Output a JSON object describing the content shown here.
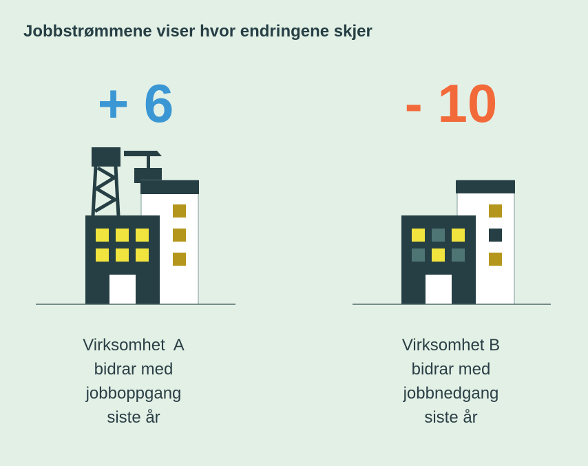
{
  "title": "Jobbstrømmene viser hvor endringene skjer",
  "colors": {
    "positive": "#3a97d4",
    "negative": "#f26a3a",
    "dark": "#263f44",
    "window_lit": "#f2e43f",
    "window_ochre": "#b5961d",
    "window_dim": "#4e7574",
    "background": "#e3f0e6"
  },
  "company_a": {
    "change": "+ 6",
    "label_lines": [
      "Virksomhet  A",
      "bidrar med",
      "jobboppgang",
      "siste år"
    ]
  },
  "company_b": {
    "change": "- 10",
    "label_lines": [
      "Virksomhet B",
      "bidrar med",
      "jobbnedgang",
      "siste år"
    ]
  }
}
